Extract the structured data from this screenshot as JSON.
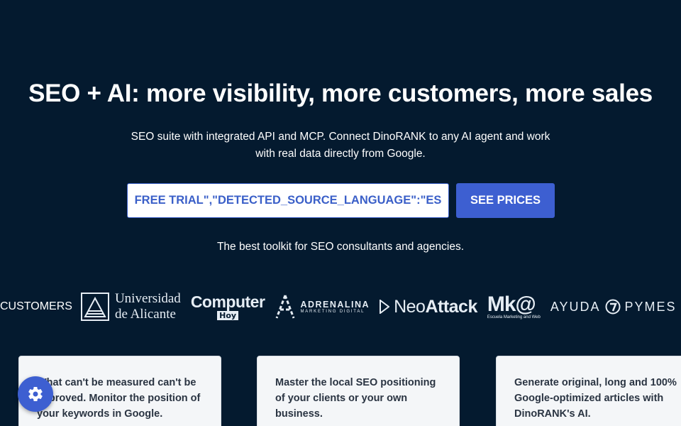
{
  "hero": {
    "title": "SEO + AI: more visibility, more customers, more sales",
    "subtitle": "SEO suite with integrated API and MCP. Connect DinoRANK to any AI agent and work with real data directly from Google."
  },
  "cta": {
    "trial_label": "FREE TRIAL\",\"DETECTED_SOURCE_LANGUAGE\":\"ES",
    "prices_label": "SEE PRICES"
  },
  "tagline": "The best toolkit for SEO consultants and agencies.",
  "customers": {
    "label": "CUSTOMERS",
    "logos": {
      "ua_line1": "Universidad",
      "ua_line2": "de Alicante",
      "computer": "Computer",
      "computer_sub": "Hoy",
      "adrenalina": "ADRENALINA",
      "adrenalina_sub": "MARKETING DIGITAL",
      "neo_light": "Neo",
      "neo_bold": "Attack",
      "mk": "Mk@",
      "mk_sub": "Escuela Marketing and Web",
      "ayuda": "AYUDA",
      "pymes": "PYMES"
    }
  },
  "cards": [
    {
      "text": "What can't be measured can't be improved. Monitor the position of your keywords in Google."
    },
    {
      "text": "Master the local SEO positioning of your clients or your own business."
    },
    {
      "text": "Generate original, long and 100% Google-optimized articles with DinoRANK's AI."
    }
  ],
  "colors": {
    "background": "#041a2f",
    "accent": "#3d5fd1",
    "card": "#f4f6f8"
  },
  "icons": {
    "settings": "gear-icon"
  }
}
